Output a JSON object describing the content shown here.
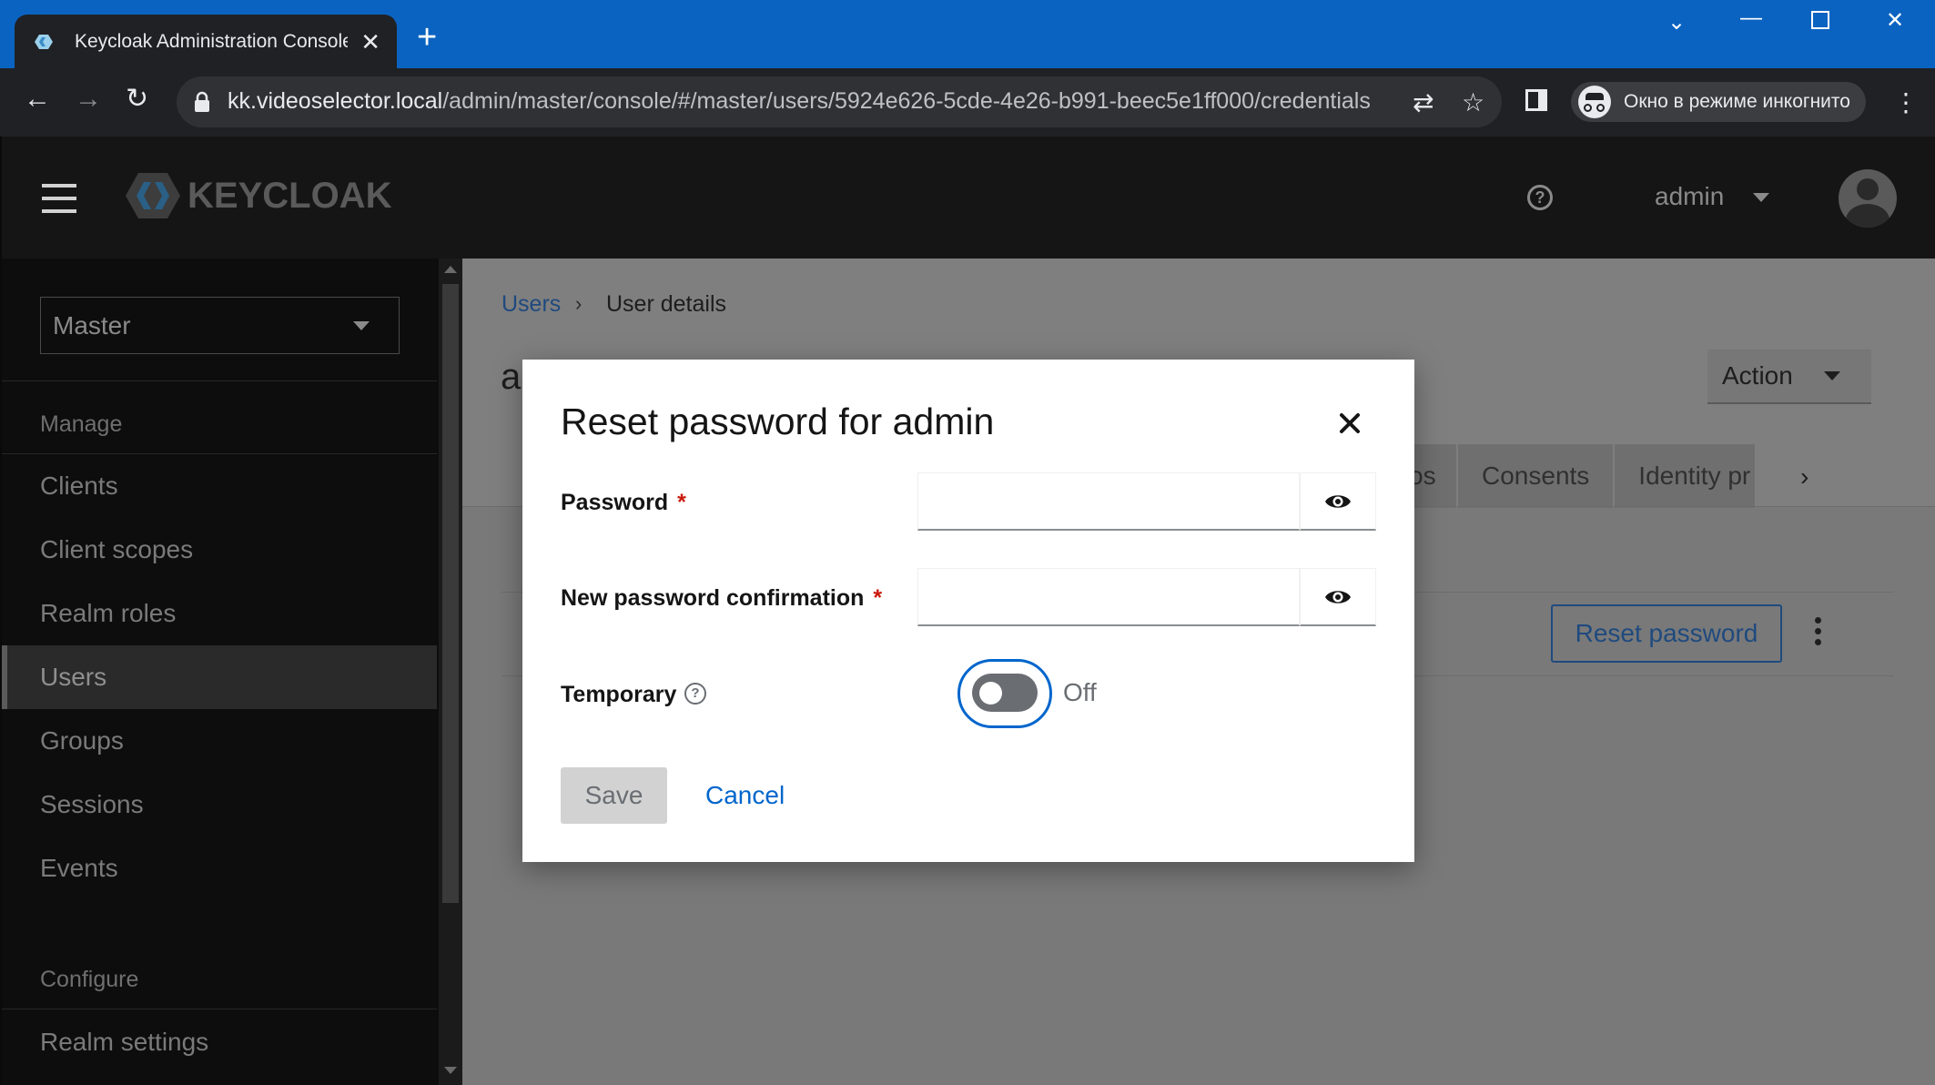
{
  "browser": {
    "tab_title": "Keycloak Administration Console",
    "url_host": "kk.videoselector.local",
    "url_path": "/admin/master/console/#/master/users/5924e626-5cde-4e26-b991-beec5e1ff000/credentials",
    "incognito_label": "Окно в режиме инкогнито"
  },
  "header": {
    "brand": "KEYCLOAK",
    "username": "admin"
  },
  "sidebar": {
    "realm": "Master",
    "groups": [
      {
        "label": "Manage"
      },
      {
        "label": "Configure"
      }
    ],
    "items": [
      {
        "label": "Clients"
      },
      {
        "label": "Client scopes"
      },
      {
        "label": "Realm roles"
      },
      {
        "label": "Users",
        "active": true
      },
      {
        "label": "Groups"
      },
      {
        "label": "Sessions"
      },
      {
        "label": "Events"
      },
      {
        "label": "Realm settings"
      }
    ]
  },
  "main": {
    "breadcrumb": {
      "parent": "Users",
      "current": "User details"
    },
    "title_peek": "a",
    "action_label": "Action",
    "tabs": [
      {
        "label": "os"
      },
      {
        "label": "Consents"
      },
      {
        "label": "Identity pr"
      }
    ],
    "reset_button": "Reset password"
  },
  "modal": {
    "title": "Reset password for admin",
    "password_label": "Password",
    "confirm_label": "New password confirmation",
    "required_mark": "*",
    "password_value": "",
    "confirm_value": "",
    "temporary_label": "Temporary",
    "toggle_state": "Off",
    "save_label": "Save",
    "cancel_label": "Cancel"
  },
  "colors": {
    "tabbar": "#0b63c1",
    "link": "#0066cc",
    "required": "#c9190b",
    "header_bg": "#151515"
  }
}
